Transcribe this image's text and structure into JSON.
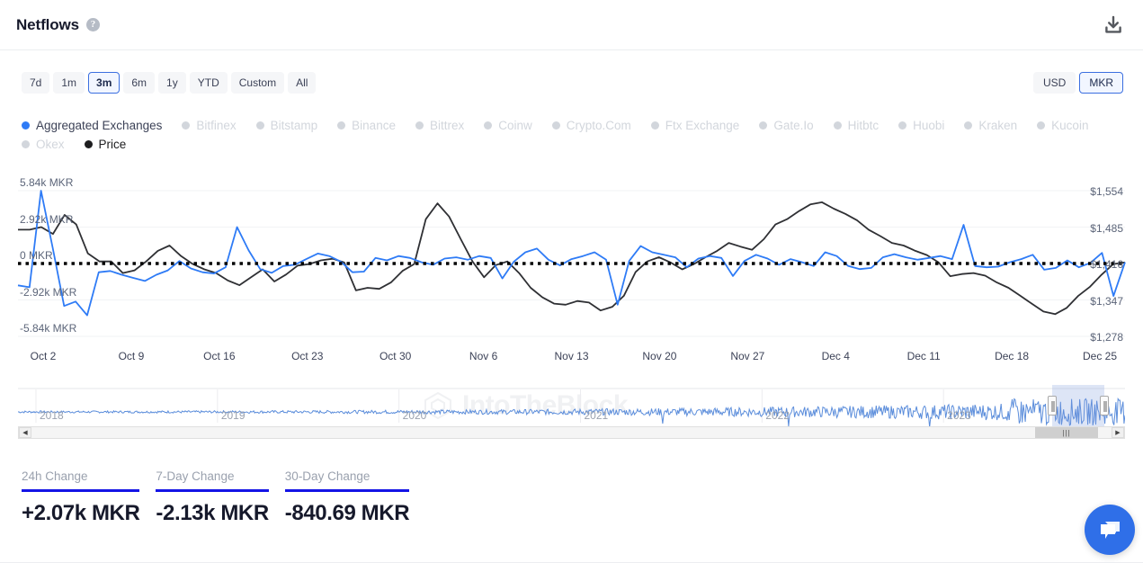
{
  "header": {
    "title": "Netflows",
    "help_icon": "question-mark-icon",
    "download_icon": "download-icon"
  },
  "controls": {
    "ranges": [
      {
        "label": "7d",
        "selected": false
      },
      {
        "label": "1m",
        "selected": false
      },
      {
        "label": "3m",
        "selected": true
      },
      {
        "label": "6m",
        "selected": false
      },
      {
        "label": "1y",
        "selected": false
      },
      {
        "label": "YTD",
        "selected": false
      },
      {
        "label": "Custom",
        "selected": false
      },
      {
        "label": "All",
        "selected": false
      }
    ],
    "units": [
      {
        "label": "USD",
        "selected": false
      },
      {
        "label": "MKR",
        "selected": true
      }
    ]
  },
  "legend": [
    {
      "label": "Aggregated Exchanges",
      "state": "active",
      "color": "#2e7bf6"
    },
    {
      "label": "Bitfinex",
      "state": "off",
      "color": "#d2d6dc"
    },
    {
      "label": "Bitstamp",
      "state": "off",
      "color": "#d2d6dc"
    },
    {
      "label": "Binance",
      "state": "off",
      "color": "#d2d6dc"
    },
    {
      "label": "Bittrex",
      "state": "off",
      "color": "#d2d6dc"
    },
    {
      "label": "Coinw",
      "state": "off",
      "color": "#d2d6dc"
    },
    {
      "label": "Crypto.Com",
      "state": "off",
      "color": "#d2d6dc"
    },
    {
      "label": "Ftx Exchange",
      "state": "off",
      "color": "#d2d6dc"
    },
    {
      "label": "Gate.Io",
      "state": "off",
      "color": "#d2d6dc"
    },
    {
      "label": "Hitbtc",
      "state": "off",
      "color": "#d2d6dc"
    },
    {
      "label": "Huobi",
      "state": "off",
      "color": "#d2d6dc"
    },
    {
      "label": "Kraken",
      "state": "off",
      "color": "#d2d6dc"
    },
    {
      "label": "Kucoin",
      "state": "off",
      "color": "#d2d6dc"
    },
    {
      "label": "Okex",
      "state": "off",
      "color": "#d2d6dc"
    },
    {
      "label": "Price",
      "state": "price",
      "color": "#1d1d1f"
    }
  ],
  "watermark": "IntoTheBlock",
  "chart_data": {
    "type": "line",
    "title": "Netflows",
    "xlabel": "",
    "ylabel": "MKR",
    "y2label": "USD",
    "grid": true,
    "legend_position": "top",
    "y_left_ticks": [
      "-5.84k MKR",
      "-2.92k MKR",
      "0 MKR",
      "2.92k MKR",
      "5.84k MKR"
    ],
    "y_left_values": [
      -5840,
      -2920,
      0,
      2920,
      5840
    ],
    "y_right_ticks": [
      "$1,278",
      "$1,347",
      "$1,416",
      "$1,485",
      "$1,554"
    ],
    "y_right_values": [
      1278,
      1347,
      1416,
      1485,
      1554
    ],
    "ylim": [
      -5840,
      5840
    ],
    "y2lim": [
      1278,
      1554
    ],
    "x_ticks": [
      "Oct 2",
      "Oct 9",
      "Oct 16",
      "Oct 23",
      "Oct 30",
      "Nov 6",
      "Nov 13",
      "Nov 20",
      "Nov 27",
      "Dec 4",
      "Dec 11",
      "Dec 18",
      "Dec 25"
    ],
    "zero_line": 0,
    "series": [
      {
        "name": "Aggregated Exchanges",
        "color": "#2e7bf6",
        "axis": "left",
        "values": [
          -1750,
          -1900,
          5840,
          1300,
          -3400,
          -3050,
          -4150,
          -700,
          -600,
          -900,
          -1150,
          -1400,
          -900,
          -550,
          200,
          -400,
          -700,
          -800,
          -300,
          2920,
          1050,
          -450,
          -750,
          -200,
          -100,
          350,
          800,
          600,
          150,
          -700,
          -650,
          450,
          250,
          600,
          450,
          100,
          -100,
          400,
          500,
          300,
          600,
          450,
          -1200,
          150,
          900,
          1200,
          300,
          -150,
          350,
          600,
          900,
          300,
          -3300,
          200,
          1400,
          900,
          700,
          500,
          -300,
          400,
          600,
          450,
          -1000,
          200,
          700,
          400,
          -100,
          350,
          100,
          -200,
          900,
          600,
          -200,
          -450,
          -350,
          500,
          750,
          500,
          300,
          450,
          600,
          350,
          3100,
          -200,
          -300,
          -250,
          100,
          350,
          700,
          -500,
          -350,
          250,
          -300,
          50,
          850,
          -2600,
          100
        ]
      },
      {
        "name": "Price",
        "color": "#2f3034",
        "axis": "right",
        "values": [
          1480,
          1480,
          1485,
          1472,
          1508,
          1490,
          1435,
          1420,
          1420,
          1398,
          1403,
          1420,
          1440,
          1450,
          1430,
          1415,
          1405,
          1398,
          1384,
          1375,
          1390,
          1405,
          1382,
          1395,
          1412,
          1415,
          1422,
          1425,
          1418,
          1365,
          1370,
          1368,
          1380,
          1402,
          1415,
          1500,
          1530,
          1505,
          1462,
          1420,
          1390,
          1413,
          1420,
          1398,
          1370,
          1352,
          1340,
          1338,
          1345,
          1342,
          1327,
          1334,
          1355,
          1400,
          1420,
          1428,
          1418,
          1405,
          1415,
          1428,
          1440,
          1455,
          1448,
          1442,
          1462,
          1490,
          1500,
          1515,
          1528,
          1532,
          1520,
          1510,
          1498,
          1480,
          1468,
          1455,
          1450,
          1440,
          1432,
          1418,
          1392,
          1396,
          1398,
          1393,
          1380,
          1370,
          1355,
          1340,
          1325,
          1320,
          1332,
          1355,
          1372,
          1395,
          1415,
          1418
        ]
      }
    ]
  },
  "navigator": {
    "years": [
      "2018",
      "2019",
      "2020",
      "2021",
      "2022",
      "2023"
    ],
    "selection_label": "3m",
    "left_arrow": "scroll-left-arrow-icon",
    "right_arrow": "scroll-right-arrow-icon"
  },
  "stats": [
    {
      "label": "24h Change",
      "value": "+2.07k MKR"
    },
    {
      "label": "7-Day Change",
      "value": "-2.13k MKR"
    },
    {
      "label": "30-Day Change",
      "value": "-840.69 MKR"
    }
  ],
  "chat": {
    "icon": "chat-bubble-icon"
  }
}
